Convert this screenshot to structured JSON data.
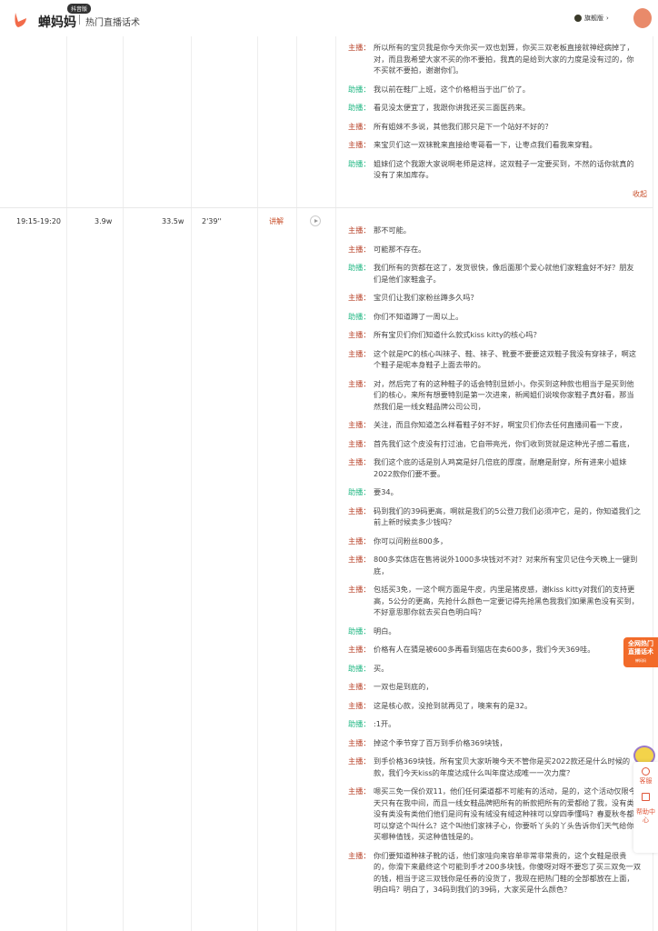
{
  "header": {
    "brand": "蝉妈妈",
    "badge": "抖音版",
    "subtitle": "热门直播话术",
    "vip": "旗舰版"
  },
  "roles": {
    "host": "主播：",
    "assist": "助播："
  },
  "collapse_label": "收起",
  "section1": [
    {
      "role": "host",
      "text": "所以所有的宝贝我是你今天你买一双也划算，你买三双老板直接就神经病掉了，对，而且我希望大家不买的你不要拍，我真的是给到大家的力度是没有过的，你不买就不要拍，谢谢你们。"
    },
    {
      "role": "assist",
      "text": "我以前在鞋厂上班，这个价格相当于出厂价了。"
    },
    {
      "role": "assist",
      "text": "看见没太便宜了，我跟你讲我还买三面医药来。"
    },
    {
      "role": "host",
      "text": "所有姐妹不多说，其他我们那只是下一个站好不好的？"
    },
    {
      "role": "host",
      "text": "来宝贝们这一双袜靴来直接给枣哥看一下，让枣点我们看我来穿鞋。"
    },
    {
      "role": "assist",
      "text": "姐妹们这个我跟大家说啊老师是这样，这双鞋子一定要买到，不然的话你就真的没有了来加库存。"
    }
  ],
  "row2": {
    "time": "19:15-19:20",
    "viewers": "3.9w",
    "sales": "33.5w",
    "duration": "2'39''",
    "type": "讲解"
  },
  "section2": [
    {
      "role": "host",
      "text": "那不可能。"
    },
    {
      "role": "host",
      "text": "可能那不存在。"
    },
    {
      "role": "assist",
      "text": "我们所有的货都在这了，发货很快，像后面那个爱心就他们家鞋盒好不好？朋友们是他们家鞋盒子。"
    },
    {
      "role": "host",
      "text": "宝贝们让我们家粉丝蹲多久吗？"
    },
    {
      "role": "assist",
      "text": "你们不知道蹲了一周以上。"
    },
    {
      "role": "host",
      "text": "所有宝贝们你们知道什么款式kiss kitty的核心吗？"
    },
    {
      "role": "host",
      "text": "这个就是PC的核心叫袜子、鞋、袜子、靴要不要要这双鞋子我没有穿袜子，啊这个鞋子是呢本身鞋子上面去带的。"
    },
    {
      "role": "host",
      "text": "对，然后完了有的这种鞋子的话会特别显娇小，你买到这种款也相当于是买到他们的核心，来所有想要特别是第一次进来，新闻姐们说唉你家鞋子真好看，那当然我们是一线女鞋品牌公司公司，"
    },
    {
      "role": "host",
      "text": "关注，而且你知道怎么样看鞋子好不好，啊宝贝们你去任何直播间看一下皮，"
    },
    {
      "role": "host",
      "text": "首先我们这个皮没有打过油，它自带亮光，你们收到货就是这种光子感二看底，"
    },
    {
      "role": "host",
      "text": "我们这个底的话是别人鸡窝是好几倍底的厚度，耐磨是耐穿，所有进来小姐妹2022款你们要不要。"
    },
    {
      "role": "assist",
      "text": "要34。"
    },
    {
      "role": "host",
      "text": "码到我们的39码更高，啊就是我们的5公登刀我们必须冲它，是的，你知道我们之前上新时候卖多少钱吗？"
    },
    {
      "role": "host",
      "text": "你可以问粉丝800多，"
    },
    {
      "role": "host",
      "text": "800多实体店在售将说外1000多块钱对不对？对来所有宝贝记住今天晚上一键到底，"
    },
    {
      "role": "host",
      "text": "包括买3免，一这个啊方面是牛皮，内里是猪皮感，谢kiss kitty对我们的支持更高，5公分的更高，先抢什么颜色一定要记得先抢黑色我我们如果黑色没有买到，不好意思那你就去买白色明白吗？"
    },
    {
      "role": "assist",
      "text": "明白。"
    },
    {
      "role": "host",
      "text": "价格有人在猜是被600多再看到猫店在卖600多，我们今天369哇。"
    },
    {
      "role": "assist",
      "text": "买。"
    },
    {
      "role": "host",
      "text": "一双也是到底的，"
    },
    {
      "role": "host",
      "text": "这是核心款，没抢到就再见了，噢来有的是32。"
    },
    {
      "role": "assist",
      "text": ":1开。"
    },
    {
      "role": "host",
      "text": "掉这个季节穿了百万到手价格369块钱，"
    },
    {
      "role": "host",
      "text": "到手价格369块钱，所有宝贝大家听噢今天不管你是买2022款还是什么时候的款，我们今天kiss的年度达成什么叫年度达成唯一一次力度？"
    },
    {
      "role": "host",
      "text": "嗯买三免一保价双11，他们任何渠道都不可能有的活动，是的，这个活动仅限今天只有在我中间，而且一线女鞋品牌把所有的新款把所有的爱都给了我，没有类没有类没有类他们他们是问有没有绒没有绒这种袜可以穿四季懂吗？春夏秋冬都可以穿这个叫什么？这个叫他们家袜子心，你要听丫头的丫头告诉你们天气给你买哪种值钱，买这种值钱是的。"
    },
    {
      "role": "host",
      "text": "你们要知道种袜子靴的话，他们家哇向来容单非常非常贵的，这个女鞋是很贵的，你滑下来最终这个可能到手才200多块钱，你傻呀对呀不要忘了买三双免一双的钱，相当于这三双钱你是任券的没货了，我现在把热门鞋的全部都放在上面，明白吗？明白了，34码到我们的39码，大家买是什么颜色？"
    }
  ],
  "float_ad": {
    "line1": "全网热门",
    "line2": "直播话术",
    "small": "蝉妈妈"
  },
  "side": {
    "service": "客服",
    "help": "帮助中心"
  }
}
